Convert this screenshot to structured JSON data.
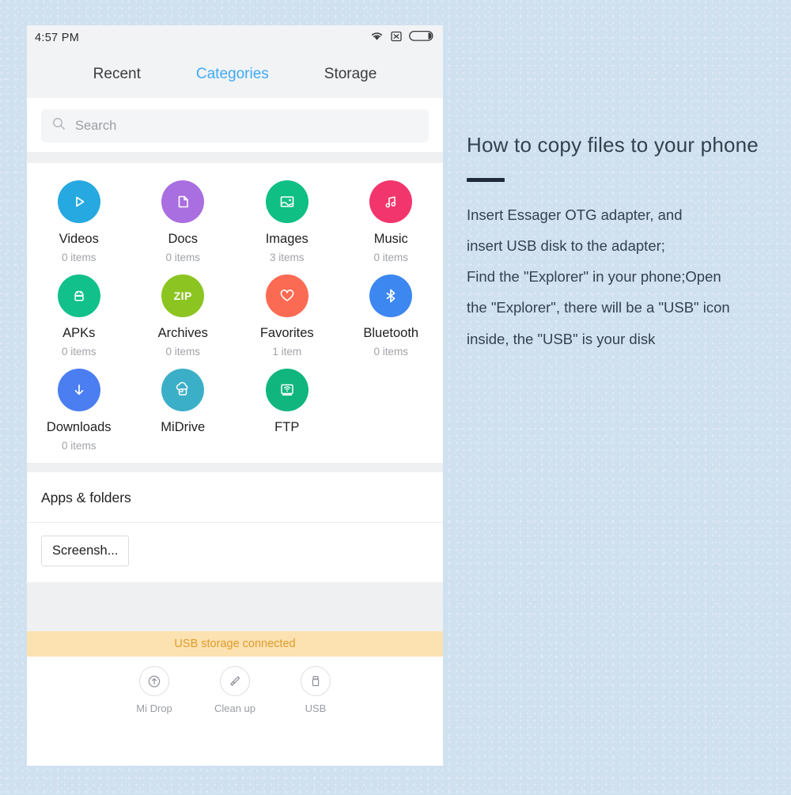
{
  "phone": {
    "statusbar": {
      "time": "4:57  PM",
      "icons": [
        "wifi-icon",
        "no-sim-icon",
        "battery-icon"
      ]
    },
    "tabs": [
      {
        "label": "Recent",
        "active": false
      },
      {
        "label": "Categories",
        "active": true
      },
      {
        "label": "Storage",
        "active": false
      }
    ],
    "search": {
      "placeholder": "Search",
      "value": ""
    },
    "categories": [
      {
        "label": "Videos",
        "count": "0 items",
        "icon": "play-icon",
        "color": "#26a9e0"
      },
      {
        "label": "Docs",
        "count": "0 items",
        "icon": "document-icon",
        "color": "#a濃"
      },
      {
        "label": "Images",
        "count": "3 items",
        "icon": "image-icon",
        "color": "#0fbf84"
      },
      {
        "label": "Music",
        "count": "0 items",
        "icon": "music-note-icon",
        "color": "#f2356d"
      },
      {
        "label": "APKs",
        "count": "0 items",
        "icon": "android-icon",
        "color": "#11c08a"
      },
      {
        "label": "Archives",
        "count": "0 items",
        "icon": "zip-icon",
        "color": "#8cc422"
      },
      {
        "label": "Favorites",
        "count": "1 item",
        "icon": "heart-icon",
        "color": "#fb6a52"
      },
      {
        "label": "Bluetooth",
        "count": "0 items",
        "icon": "bluetooth-icon",
        "color": "#3d87f0"
      },
      {
        "label": "Downloads",
        "count": "0 items",
        "icon": "download-icon",
        "color": "#4b7ef0"
      },
      {
        "label": "MiDrive",
        "count": "",
        "icon": "cloud-box-icon",
        "color": "#3cafc8"
      },
      {
        "label": "FTP",
        "count": "",
        "icon": "ftp-wifi-icon",
        "color": "#11b67f"
      }
    ],
    "apps_section": {
      "title": "Apps & folders",
      "chips": [
        "Screensh..."
      ]
    },
    "usb_banner": {
      "text": "USB storage connected",
      "bg": "#fce2b0",
      "fg": "#e09b2d"
    },
    "bottom_bar": [
      {
        "label": "Mi Drop",
        "icon": "upload-circle-icon"
      },
      {
        "label": "Clean up",
        "icon": "brush-icon"
      },
      {
        "label": "USB",
        "icon": "usb-drive-icon"
      }
    ]
  },
  "copy": {
    "title": "How to copy files to your phone",
    "lines": [
      "Insert Essager OTG adapter, and",
      "insert USB disk to the adapter;",
      "Find the \"Explorer\" in your phone;Open",
      "the \"Explorer\", there will be a \"USB\" icon",
      "inside, the \"USB\" is your disk"
    ]
  },
  "theme": {
    "backdrop": "#cfe0ef",
    "accent_rule": "#1d2b3a",
    "tab_active": "#3fa9f5"
  }
}
